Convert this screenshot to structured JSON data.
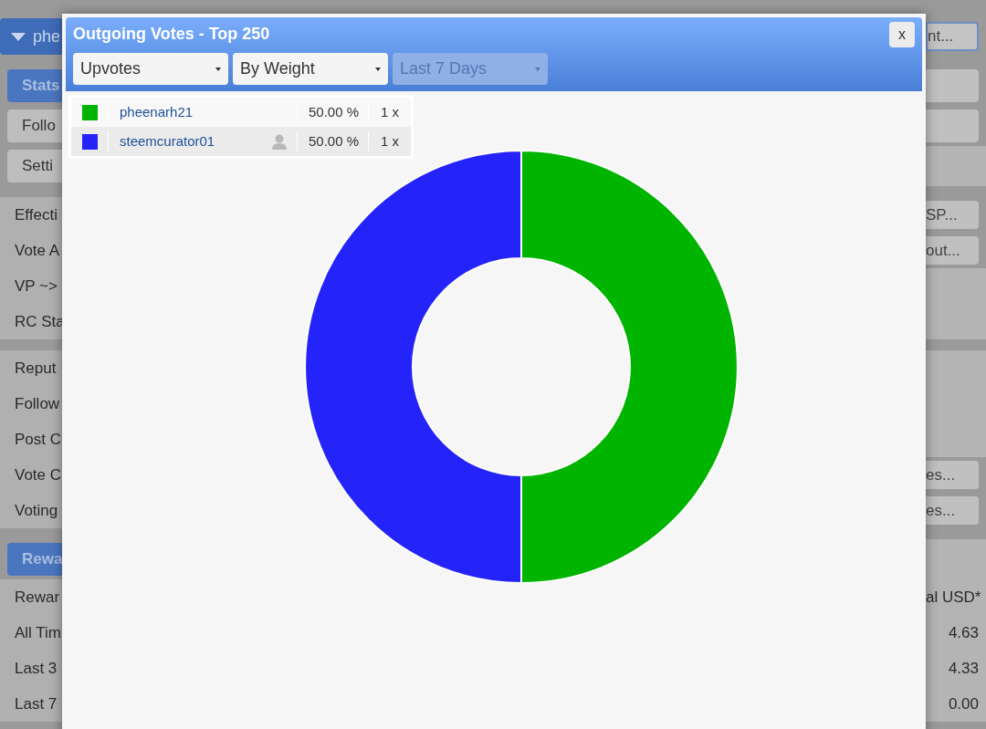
{
  "background": {
    "rows": [
      {
        "kind": "header",
        "label": "phe",
        "action": "nt..."
      },
      {
        "kind": "gap"
      },
      {
        "kind": "tab",
        "label": "Stats",
        "blank_button": true
      },
      {
        "kind": "button",
        "label": "Follo",
        "blank_button": true
      },
      {
        "kind": "button",
        "label": "Setti"
      },
      {
        "kind": "gap"
      },
      {
        "kind": "row",
        "label": "Effecti",
        "action": "SP..."
      },
      {
        "kind": "row",
        "label": "Vote A",
        "action": "out..."
      },
      {
        "kind": "row",
        "label": "VP ~>"
      },
      {
        "kind": "row",
        "label": "RC Sta"
      },
      {
        "kind": "gap"
      },
      {
        "kind": "row",
        "label": "Reput"
      },
      {
        "kind": "row",
        "label": "Follow"
      },
      {
        "kind": "row",
        "label": "Post C"
      },
      {
        "kind": "row",
        "label": "Vote C",
        "action": "es..."
      },
      {
        "kind": "row",
        "label": "Voting",
        "action": "es..."
      },
      {
        "kind": "gap"
      },
      {
        "kind": "tab",
        "label": "Rewa"
      },
      {
        "kind": "row",
        "label": "Rewar",
        "value": "al USD*"
      },
      {
        "kind": "row",
        "label": "All Tim",
        "value": "4.63"
      },
      {
        "kind": "row",
        "label": "Last 3",
        "value": "4.33"
      },
      {
        "kind": "row",
        "label": "Last 7",
        "value": "0.00"
      }
    ]
  },
  "dialog": {
    "title": "Outgoing Votes - Top 250",
    "close": "x",
    "selects": [
      {
        "value": "Upvotes",
        "disabled": false
      },
      {
        "value": "By Weight",
        "disabled": false
      },
      {
        "value": "Last 7 Days",
        "disabled": true
      }
    ],
    "legend": [
      {
        "color": "#00b400",
        "profile_icon": false,
        "share": "50.00 %",
        "count": "1 x"
      },
      {
        "color": "#2424fa",
        "profile_icon": true,
        "share": "50.00 %",
        "count": "1 x"
      }
    ],
    "chart_data": {
      "type": "donut",
      "categories": [
        "pheenarh21",
        "steemcurator01"
      ],
      "values": [
        50,
        50
      ]
    }
  }
}
